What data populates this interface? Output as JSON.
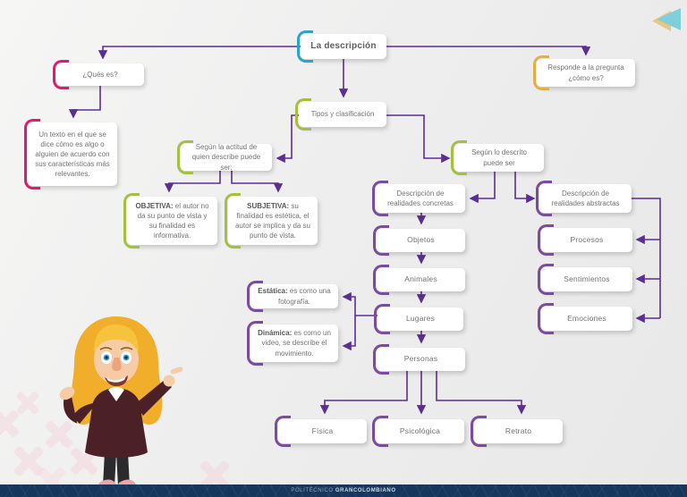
{
  "colors": {
    "line": "#5b2e91",
    "teal": "#2aa5c6",
    "pink": "#e3186f",
    "green": "#a3c13e",
    "yellow": "#e3ad49",
    "purple": "#7b4ba0",
    "navy": "#17365b",
    "textc": "#737373",
    "leadc": "#575757",
    "xpink": "#f4d8e0",
    "navfront": "#7fd0da",
    "navyellow": "#eac683"
  },
  "map": {
    "title": "La descripción",
    "ques": "¿Qués es?",
    "responde": "Responde a la pregunta ¿cómo es?",
    "texto": "Un texto en el que se dice cómo es algo o alguien de acuerdo con sus características más relevantes.",
    "tipos": "Tipos y clasificación",
    "actitud": "Según la actitud de quien describe puede ser:",
    "descrito": "Según lo descrito puede ser",
    "objetiva_lead": "OBJETIVA:",
    "objetiva_rest": " el autor no da su punto de vista y su finalidad es informativa.",
    "subjetiva_lead": "SUBJETIVA:",
    "subjetiva_rest": " su finalidad es estética, el autor se implica y da su punto de vista.",
    "concretas": "Descripción de realidades concretas",
    "abstractas": "Descripción de realidades abstractas",
    "objetos": "Objetos",
    "animales": "Animales",
    "lugares": "Lugares",
    "personas": "Personas",
    "procesos": "Procesos",
    "sentimientos": "Sentimientos",
    "emociones": "Emociones",
    "estatica_lead": "Estática:",
    "estatica_rest": " es como una fotografía.",
    "dinamica_lead": "Dinámica:",
    "dinamica_rest": " es como un video, se describe el movimiento.",
    "fisica": "Física",
    "psicologica": "Psicológica",
    "retrato": "Retrato"
  },
  "nav": {
    "back_icon": "back-arrow"
  },
  "footer": {
    "brand_light": "POLITÉCNICO",
    "brand_bold": "GRANCOLOMBIANO"
  }
}
